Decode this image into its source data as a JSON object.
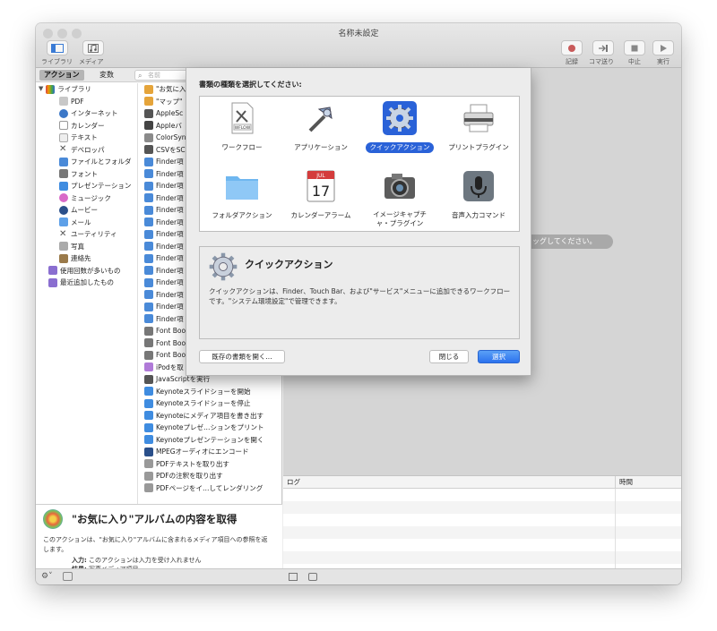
{
  "window": {
    "title": "名称未設定"
  },
  "toolbar": {
    "library_label": "ライブラリ",
    "media_label": "メディア",
    "record_label": "記録",
    "step_label": "コマ送り",
    "stop_label": "中止",
    "run_label": "実行"
  },
  "left": {
    "tab_actions": "アクション",
    "tab_variables": "変数",
    "search_placeholder": "名前",
    "tree": [
      "ライブラリ",
      "PDF",
      "インターネット",
      "カレンダー",
      "テキスト",
      "デベロッパ",
      "ファイルとフォルダ",
      "フォント",
      "プレゼンテーション",
      "ミュージック",
      "ムービー",
      "メール",
      "ユーティリティ",
      "写真",
      "連絡先",
      "使用回数が多いもの",
      "最近追加したもの"
    ],
    "actions": [
      "\"お気に入",
      "\"マップ\"",
      "AppleSc",
      "Appleバ",
      "ColorSyn",
      "CSVをSC",
      "Finder項",
      "Finder項",
      "Finder項",
      "Finder項",
      "Finder項",
      "Finder項",
      "Finder項",
      "Finder項",
      "Finder項",
      "Finder項",
      "Finder項",
      "Finder項",
      "Finder項",
      "Finder項",
      "Font Boo",
      "Font Boo",
      "Font Boo",
      "iPodを取",
      "JavaScriptを実行",
      "Keynoteスライドショーを開始",
      "Keynoteスライドショーを停止",
      "Keynoteにメディア項目を書き出す",
      "Keynoteプレゼ…ションをプリント",
      "Keynoteプレゼンテーションを開く",
      "MPEGオーディオにエンコード",
      "PDFテキストを取り出す",
      "PDFの注釈を取り出す",
      "PDFページをイ…してレンダリング"
    ],
    "description": {
      "title": "\"お気に入り\"アルバムの内容を取得",
      "body": "このアクションは、\"お気に入り\"アルバムに含まれるメディア項目への参照を返します。",
      "input_label": "入力:",
      "input_value": "このアクションは入力を受け入れません",
      "result_label": "結果:",
      "result_value": "写真メディア項目"
    }
  },
  "workflow": {
    "drag_hint": "イルをドラッグしてください。"
  },
  "log": {
    "col_log": "ログ",
    "col_time": "時間"
  },
  "sheet": {
    "heading": "書類の種類を選択してください:",
    "types": [
      {
        "label": "ワークフロー",
        "icon": "workflow-icon",
        "badge": "WFLOW"
      },
      {
        "label": "アプリケーション",
        "icon": "application-icon"
      },
      {
        "label": "クイックアクション",
        "icon": "gear-icon",
        "selected": true
      },
      {
        "label": "プリントプラグイン",
        "icon": "printer-icon"
      },
      {
        "label": "フォルダアクション",
        "icon": "folder-icon"
      },
      {
        "label": "カレンダーアラーム",
        "icon": "calendar-icon",
        "month": "JUL",
        "day": "17"
      },
      {
        "label": "イメージキャプチャ・プラグイン",
        "icon": "camera-icon",
        "label_line1": "イメージキャプチ",
        "label_line2": "ャ・プラグイン"
      },
      {
        "label": "音声入力コマンド",
        "icon": "microphone-icon"
      }
    ],
    "info_title": "クイックアクション",
    "info_body": "クイックアクションは、Finder、Touch Bar、および\"サービス\"メニューに追加できるワークフローです。\"システム環境設定\"で管理できます。",
    "open_existing": "既存の書類を開く...",
    "close": "閉じる",
    "choose": "選択"
  },
  "colors": {
    "accent": "#2a62d8",
    "selection_blue": "#2c72ee"
  }
}
